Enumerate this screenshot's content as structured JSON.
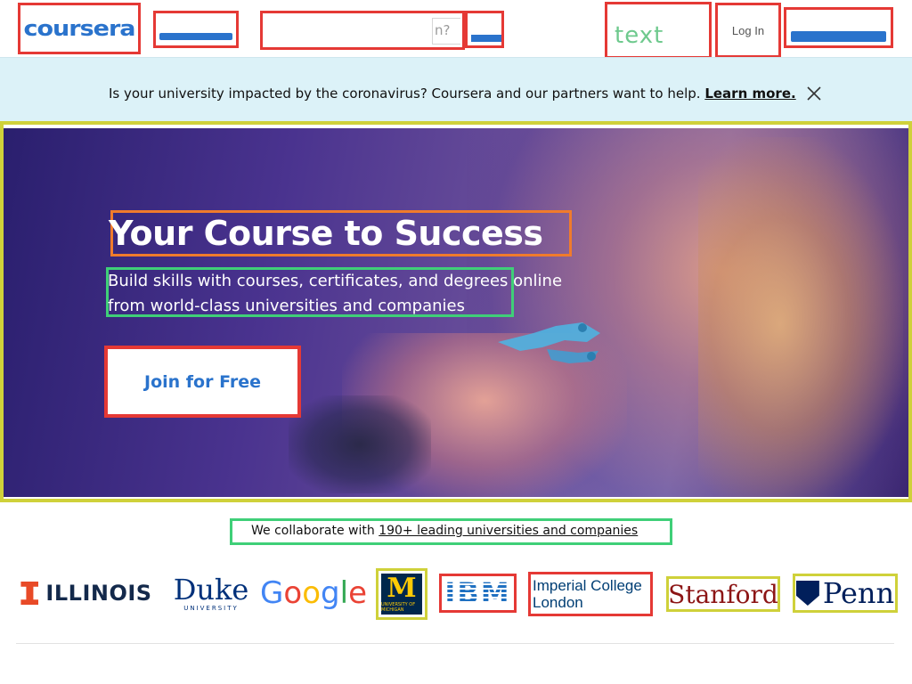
{
  "header": {
    "logo_text": "coursera",
    "search_placeholder": "n?",
    "universities_label": "text",
    "login_label": "Log In"
  },
  "banner": {
    "message": "Is your university impacted by the coronavirus? Coursera and our partners want to help.",
    "link_label": "Learn more."
  },
  "hero": {
    "heading": "Your Course to Success",
    "subheading": "Build skills with courses, certificates, and degrees online from world-class universities and companies",
    "cta_label": "Join for Free"
  },
  "partners": {
    "intro": "We collaborate with",
    "link": "190+ leading universities and companies",
    "logos": {
      "illinois": "ILLINOIS",
      "duke": "Duke",
      "duke_sub": "UNIVERSITY",
      "google": "Google",
      "michigan": "M",
      "michigan_sub": "UNIVERSITY OF MICHIGAN",
      "ibm": "IBM",
      "imperial_line1": "Imperial College",
      "imperial_line2": "London",
      "stanford": "Stanford",
      "penn": "Penn"
    }
  },
  "colors": {
    "brand_blue": "#2a73cc",
    "banner_bg": "#dcf2f8",
    "hero_purple": "#4a338f"
  }
}
